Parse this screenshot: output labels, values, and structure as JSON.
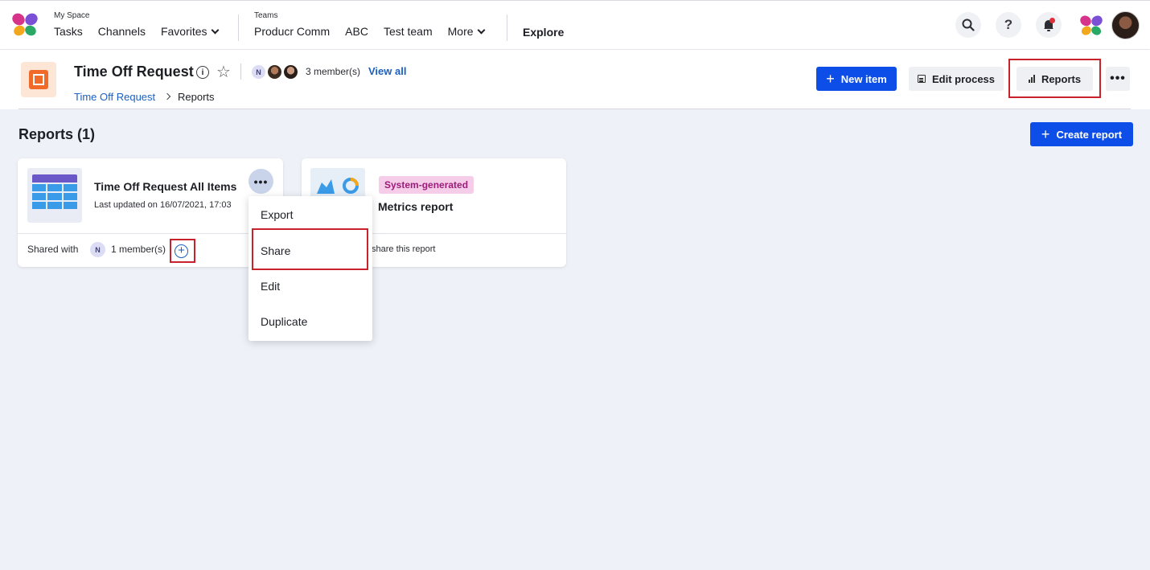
{
  "nav": {
    "my_space_label": "My Space",
    "my_space_items": [
      "Tasks",
      "Channels",
      "Favorites"
    ],
    "teams_label": "Teams",
    "teams_items": [
      "Producr Comm",
      "ABC",
      "Test team",
      "More"
    ],
    "explore": "Explore",
    "search_icon": "search-icon",
    "help_glyph": "?",
    "bell_icon": "bell-icon"
  },
  "header": {
    "title": "Time Off Request",
    "avatar_initial": "N",
    "members": "3 member(s)",
    "view_all": "View all",
    "breadcrumb": [
      "Time Off Request",
      "Reports"
    ],
    "new_item": "New item",
    "edit_process": "Edit process",
    "reports": "Reports"
  },
  "main": {
    "reports_title": "Reports (1)",
    "create_report": "Create report",
    "cards": [
      {
        "title": "Time Off Request All Items",
        "updated": "Last updated on 16/07/2021, 17:03",
        "shared_label": "Shared with",
        "shared_initial": "N",
        "shared_count": "1 member(s)"
      },
      {
        "badge": "System-generated",
        "title": "Metrics report",
        "footer": "share this report"
      }
    ]
  },
  "menu": {
    "items": [
      "Export",
      "Share",
      "Edit",
      "Duplicate"
    ]
  },
  "colors": {
    "primary": "#0d4ee8",
    "link": "#1b5fc1",
    "highlight": "#c8232c",
    "badge_bg": "#f5cde8",
    "badge_text": "#9c1c7a"
  }
}
